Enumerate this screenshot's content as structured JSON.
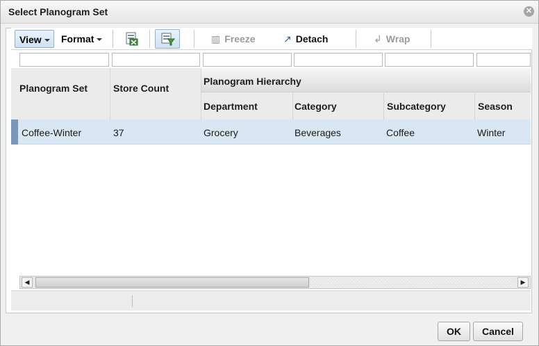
{
  "dialog": {
    "title": "Select Planogram Set",
    "close_glyph": "✕"
  },
  "toolbar": {
    "view_label": "View",
    "format_label": "Format",
    "export_icon": "export-to-excel-icon",
    "query_by_example_icon": "query-by-example-icon",
    "freeze_label": "Freeze",
    "detach_label": "Detach",
    "wrap_label": "Wrap",
    "freeze_glyph": "▥",
    "detach_glyph": "↗",
    "wrap_glyph": "↲"
  },
  "table": {
    "group_header": "Planogram Hierarchy",
    "columns": {
      "planogram_set": "Planogram Set",
      "store_count": "Store Count",
      "department": "Department",
      "category": "Category",
      "subcategory": "Subcategory",
      "season": "Season"
    },
    "rows": [
      {
        "planogram_set": "Coffee-Winter",
        "store_count": "37",
        "department": "Grocery",
        "category": "Beverages",
        "subcategory": "Coffee",
        "season": "Winter"
      }
    ]
  },
  "buttons": {
    "ok": "OK",
    "cancel": "Cancel"
  },
  "colors": {
    "selected_row": "#d9e6f3",
    "accent": "#8fb2d4",
    "header": "#ebebeb"
  }
}
